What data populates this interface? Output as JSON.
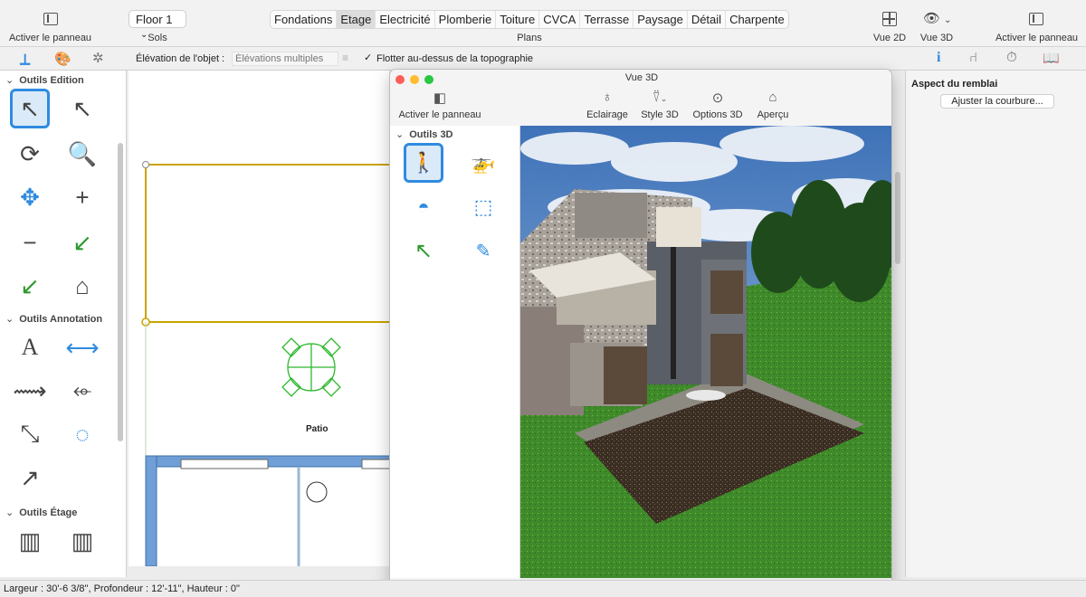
{
  "toolbar": {
    "left_panel_btn": "Activer le panneau",
    "floor_select": "Floor 1",
    "floor_caption": "Sols",
    "plans_caption": "Plans",
    "tabs": [
      "Fondations",
      "Etage",
      "Electricité",
      "Plomberie",
      "Toiture",
      "CVCA",
      "Terrasse",
      "Paysage",
      "Détail",
      "Charpente"
    ],
    "active_tab": "Etage",
    "view2d": "Vue 2D",
    "view3d": "Vue 3D",
    "right_panel_btn": "Activer le panneau"
  },
  "secondbar": {
    "elevation_label": "Élévation de l'objet :",
    "elevation_placeholder": "Élévations multiples",
    "float_checkbox_label": "Flotter au-dessus de la topographie",
    "float_checked": true
  },
  "left_panel": {
    "sections": [
      {
        "title": "Outils Edition"
      },
      {
        "title": "Outils Annotation"
      },
      {
        "title": "Outils Étage"
      }
    ]
  },
  "canvas": {
    "patio_label": "Patio"
  },
  "window3d": {
    "title": "Vue 3D",
    "panel_btn": "Activer le panneau",
    "buttons": [
      "Eclairage",
      "Style 3D",
      "Options 3D",
      "Aperçu"
    ],
    "tools_section": "Outils 3D"
  },
  "right_panel": {
    "title": "Aspect du remblai",
    "adjust_button": "Ajuster la courbure..."
  },
  "status": {
    "text": "Largeur : 30'-6 3/8\", Profondeur : 12'-11\", Hauteur : 0\""
  },
  "colors": {
    "accent": "#2f8be0",
    "selection_yellow": "#c9a400",
    "wall_blue": "#6f9fd6",
    "grass": "#3f8a2a",
    "close": "#fe5f57",
    "minimize": "#febc2e",
    "zoom": "#28c840"
  }
}
